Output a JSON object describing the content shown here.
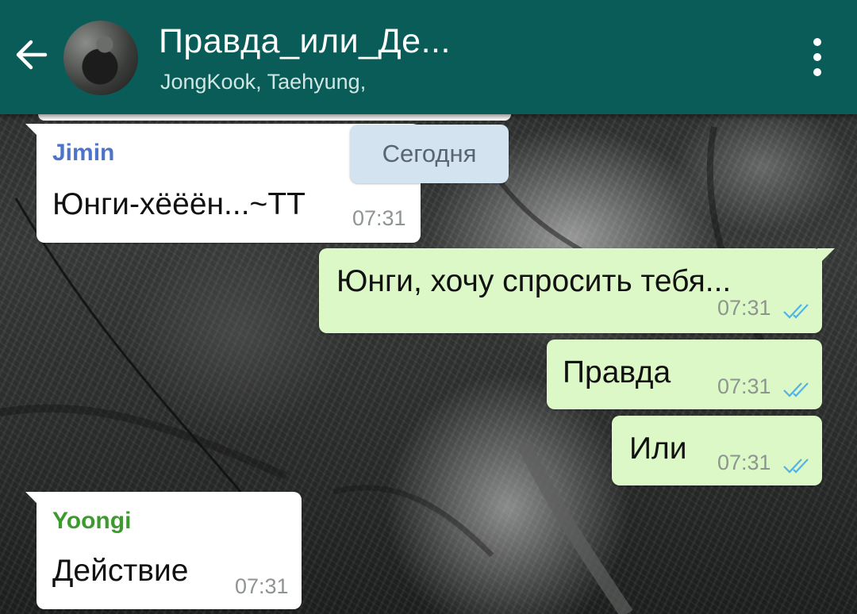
{
  "header": {
    "title": "Правда_или_Де...",
    "subtitle": "JongKook, Taehyung,",
    "back_icon": "arrow-left-icon",
    "menu_icon": "more-vertical-icon",
    "background_color": "#0a5c58"
  },
  "date_chip": "Сегодня",
  "messages": [
    {
      "direction": "incoming",
      "sender": "Jimin",
      "sender_color": "#4e74c9",
      "text": "Юнги-хёёён...~ТТ",
      "time": "07:31"
    },
    {
      "direction": "outgoing",
      "text": "Юнги, хочу спросить тебя...",
      "time": "07:31",
      "status_icon": "double-check-icon"
    },
    {
      "direction": "outgoing",
      "text": "Правда",
      "time": "07:31",
      "status_icon": "double-check-icon"
    },
    {
      "direction": "outgoing",
      "text": "Или",
      "time": "07:31",
      "status_icon": "double-check-icon"
    },
    {
      "direction": "incoming",
      "sender": "Yoongi",
      "sender_color": "#3d9a2f",
      "text": "Действие",
      "time": "07:31"
    }
  ],
  "colors": {
    "incoming_bubble": "#ffffff",
    "outgoing_bubble": "#dcf8c6",
    "read_ticks": "#4fb3e8"
  }
}
